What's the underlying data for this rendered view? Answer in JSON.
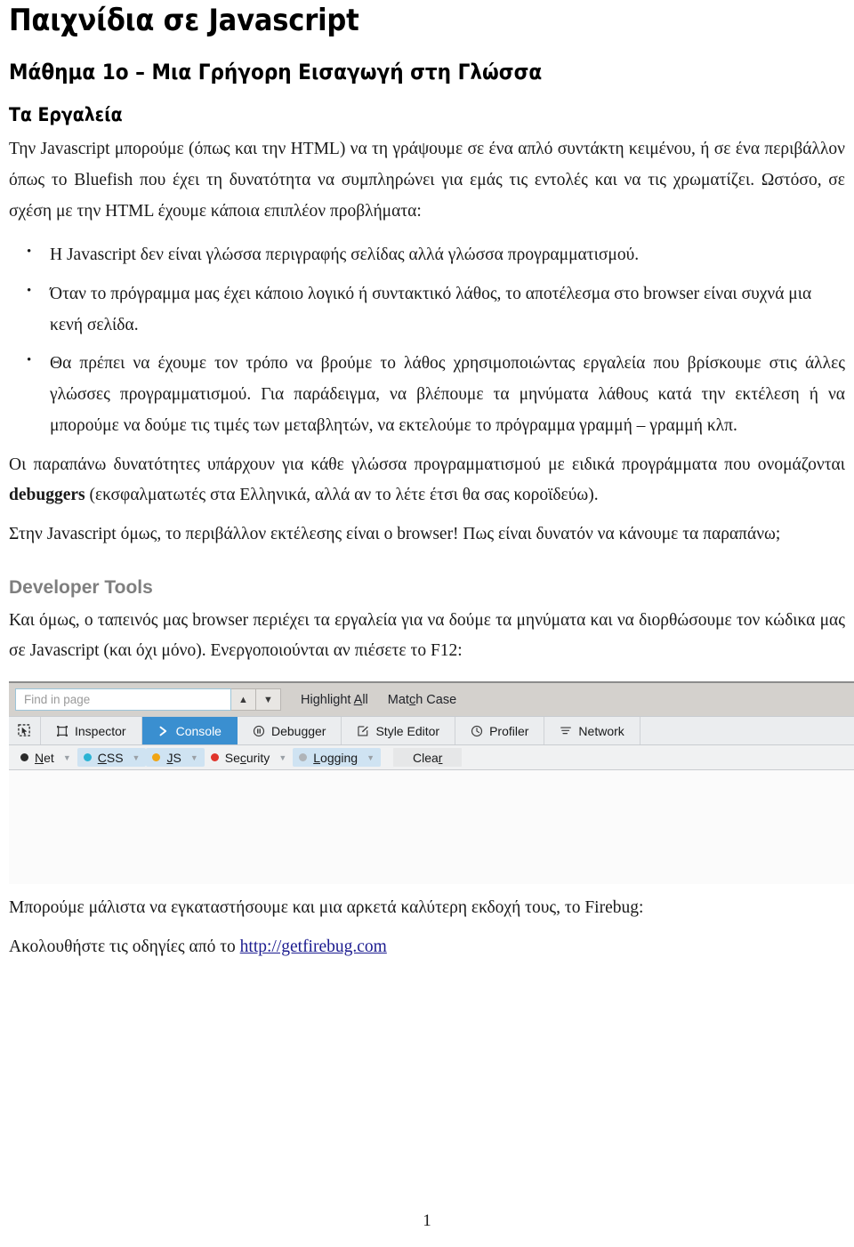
{
  "document": {
    "title": "Παιχνίδια σε Javascript",
    "subtitle": "Μάθημα 1ο – Μια Γρήγορη Εισαγωγή στη Γλώσσα",
    "section_tools": "Τα Εργαλεία",
    "section_devtools": "Developer Tools",
    "page_number": "1"
  },
  "intro": {
    "paragraph": "Την Javascript μπορούμε (όπως και την HTML) να τη γράψουμε σε ένα απλό συντάκτη κειμένου, ή σε ένα περιβάλλον όπως το Bluefish που έχει τη δυνατότητα να συμπληρώνει για εμάς τις εντολές και να τις χρωματίζει. Ωστόσο, σε σχέση με την HTML έχουμε κάποια επιπλέον προβλήματα:"
  },
  "bullets": [
    "Η Javascript δεν είναι γλώσσα περιγραφής σελίδας αλλά γλώσσα προγραμματισμού.",
    "Όταν το πρόγραμμα μας έχει κάποιο λογικό ή συντακτικό λάθος, το αποτέλεσμα στο browser είναι συχνά μια κενή σελίδα.",
    "Θα πρέπει να έχουμε τον τρόπο να βρούμε το λάθος χρησιμοποιώντας εργαλεία που βρίσκουμε στις άλλες γλώσσες προγραμματισμού. Για παράδειγμα, να βλέπουμε τα μηνύματα λάθους κατά την εκτέλεση ή να μπορούμε να δούμε τις τιμές των μεταβλητών, να εκτελούμε το πρόγραμμα γραμμή – γραμμή κλπ."
  ],
  "debuggers_para": {
    "before": "Οι παραπάνω δυνατότητες υπάρχουν για κάθε γλώσσα προγραμματισμού με ειδικά προγράμματα που ονομάζονται ",
    "bold": "debuggers",
    "after": " (εκσφαλματωτές στα Ελληνικά, αλλά αν το λέτε έτσι θα σας κοροϊδεύω)."
  },
  "browser_para": "Στην Javascript όμως, το περιβάλλον εκτέλεσης είναι ο browser! Πως είναι δυνατόν να κάνουμε τα παραπάνω;",
  "devtools_para": "Και όμως, ο ταπεινός μας browser περιέχει τα εργαλεία για να δούμε τα μηνύματα και να διορθώσουμε τον κώδικα μας σε Javascript (και όχι μόνο). Ενεργοποιούνται αν πιέσετε το F12:",
  "firebug": {
    "line1": "Μπορούμε μάλιστα να εγκαταστήσουμε και μια αρκετά καλύτερη εκδοχή τους, το Firebug:",
    "line2_before": "Ακολουθήστε τις οδηγίες από το ",
    "link_text": "http://getfirebug.com"
  },
  "screenshot": {
    "findbar": {
      "placeholder": "Find in page",
      "prev_icon": "chevron-up-icon",
      "next_icon": "chevron-down-icon",
      "highlight_all": {
        "pre": "Highlight ",
        "accel": "A",
        "post": "ll"
      },
      "match_case": {
        "pre": "Mat",
        "accel": "c",
        "post": "h Case"
      }
    },
    "tabs": [
      {
        "label": "",
        "icon": "element-picker-icon",
        "active": false
      },
      {
        "label": "Inspector",
        "icon": "inspector-icon",
        "active": false
      },
      {
        "label": "Console",
        "icon": "console-chevron-icon",
        "active": true
      },
      {
        "label": "Debugger",
        "icon": "debugger-pause-icon",
        "active": false
      },
      {
        "label": "Style Editor",
        "icon": "style-editor-icon",
        "active": false
      },
      {
        "label": "Profiler",
        "icon": "profiler-clock-icon",
        "active": false
      },
      {
        "label": "Network",
        "icon": "network-icon",
        "active": false
      }
    ],
    "filters": [
      {
        "pre": "",
        "accel": "N",
        "post": "et",
        "dot": "#2b2b2b",
        "active": false
      },
      {
        "pre": "",
        "accel": "C",
        "post": "SS",
        "dot": "#2ab3d4",
        "active": true
      },
      {
        "pre": "",
        "accel": "J",
        "post": "S",
        "dot": "#f0a514",
        "active": true
      },
      {
        "pre": "Se",
        "accel": "c",
        "post": "urity",
        "dot": "#e0342b",
        "active": false
      },
      {
        "pre": "",
        "accel": "L",
        "post": "ogging",
        "dot": "#b0b4b8",
        "active": true
      }
    ],
    "clear": {
      "pre": "Clea",
      "accel": "r",
      "post": ""
    },
    "accent_blue": "#3a8fd0",
    "filter_active_bg": "#cfe3f2"
  }
}
